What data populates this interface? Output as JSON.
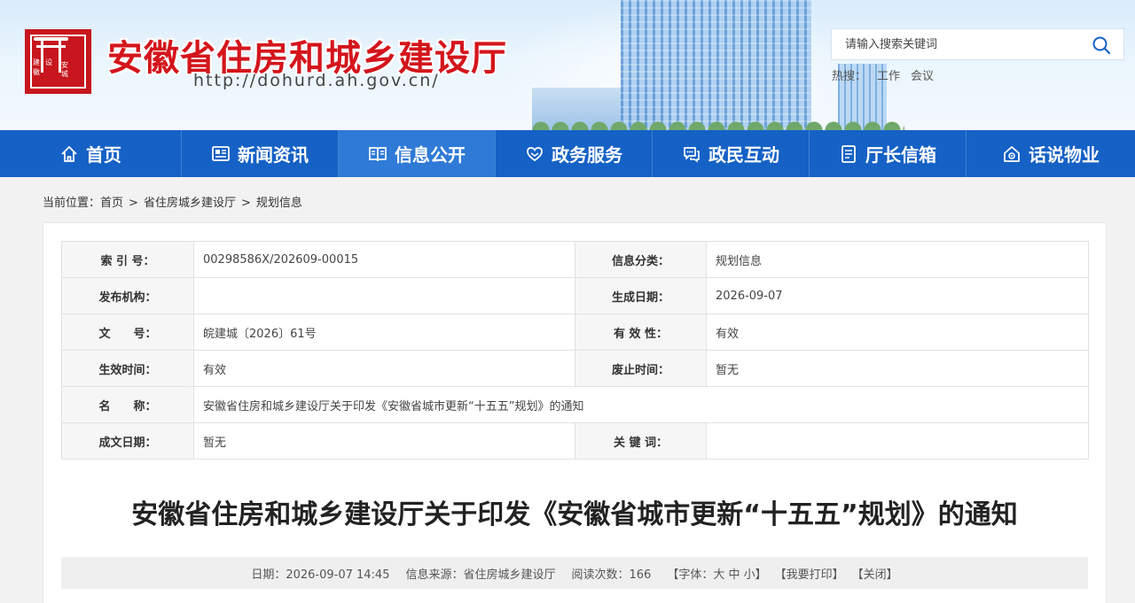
{
  "header": {
    "title": "安徽省住房和城乡建设厅",
    "url": "http://dohurd.ah.gov.cn/",
    "logo_text": [
      "建",
      "设",
      "安",
      "徽",
      "城"
    ],
    "search_placeholder": "请输入搜索关键词",
    "hot_label": "热搜：",
    "hot_items": [
      "工作",
      "会议"
    ]
  },
  "nav": {
    "items": [
      {
        "label": "首页",
        "icon": "home-icon"
      },
      {
        "label": "新闻资讯",
        "icon": "news-icon"
      },
      {
        "label": "信息公开",
        "icon": "book-icon"
      },
      {
        "label": "政务服务",
        "icon": "service-icon"
      },
      {
        "label": "政民互动",
        "icon": "chat-icon"
      },
      {
        "label": "厅长信箱",
        "icon": "mailbox-icon"
      },
      {
        "label": "话说物业",
        "icon": "property-icon"
      }
    ],
    "active_index": 2
  },
  "breadcrumb": {
    "prefix": "当前位置：",
    "items": [
      "首页",
      "省住房城乡建设厅",
      "规划信息"
    ],
    "separator": ">"
  },
  "info": {
    "index_label": "索 引 号：",
    "index_value": "00298586X/202609-00015",
    "category_label": "信息分类：",
    "category_value": "规划信息",
    "publisher_label": "发布机构：",
    "publisher_value": "",
    "created_label": "生成日期：",
    "created_value": "2026-09-07",
    "docno_label": "文　　号：",
    "docno_value": "皖建城〔2026〕61号",
    "validity_label": "有 效 性：",
    "validity_value": "有效",
    "effective_label": "生效时间：",
    "effective_value": "有效",
    "repeal_label": "废止时间：",
    "repeal_value": "暂无",
    "name_label": "名　　称：",
    "name_value": "安徽省住房和城乡建设厅关于印发《安徽省城市更新“十五五”规划》的通知",
    "completed_label": "成文日期：",
    "completed_value": "暂无",
    "keywords_label": "关 键 词：",
    "keywords_value": ""
  },
  "article": {
    "title": "安徽省住房和城乡建设厅关于印发《安徽省城市更新“十五五”规划》的通知",
    "date": "日期：2026-09-07 14:45",
    "source": "信息来源：省住房城乡建设厅",
    "views": "阅读次数：166",
    "font_label": "【字体：",
    "font_large": "大",
    "font_medium": "中",
    "font_small": "小】",
    "print": "【我要打印】",
    "close": "【关闭】"
  },
  "colors": {
    "brand_red": "#d4151c",
    "nav_blue": "#1561c5",
    "nav_active": "#2f7ad6"
  }
}
